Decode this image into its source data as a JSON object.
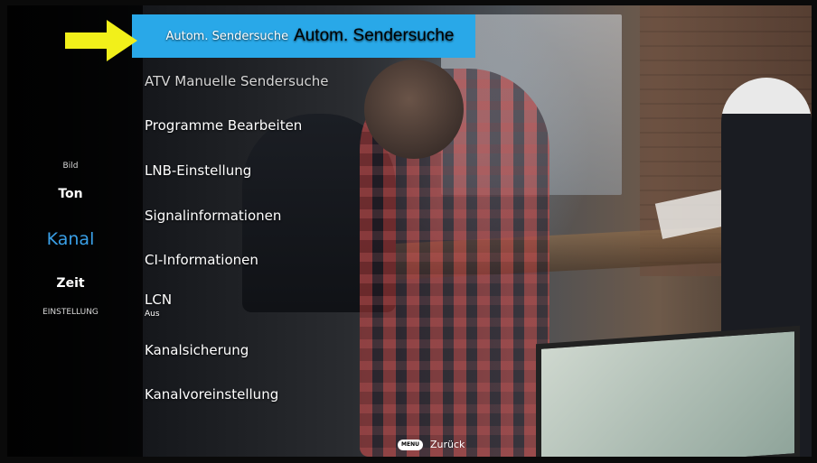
{
  "categories": {
    "faint_top": "",
    "bild": "Bild",
    "ton": "Ton",
    "kanal": "Kanal",
    "zeit": "Zeit",
    "einstellung": "EINSTELLUNG",
    "faint_bottom": ""
  },
  "menu": {
    "selected": {
      "label": "Autom. Sendersuche",
      "label_large": "Autom. Sendersuche"
    },
    "items": [
      {
        "label": "ATV Manuelle Sendersuche"
      },
      {
        "label": "Programme Bearbeiten"
      },
      {
        "label": "LNB-Einstellung"
      },
      {
        "label": "Signalinformationen"
      },
      {
        "label": "CI-Informationen"
      },
      {
        "label": "LCN",
        "value": "Aus"
      },
      {
        "label": "Kanalsicherung"
      },
      {
        "label": "Kanalvoreinstellung"
      }
    ]
  },
  "footer": {
    "key": "MENU",
    "label": "Zurück"
  },
  "colors": {
    "accent": "#29a8e8",
    "active_category": "#3aa0e8",
    "arrow": "#f2f01a"
  },
  "icons": {
    "pointer": "arrow-right-icon"
  }
}
